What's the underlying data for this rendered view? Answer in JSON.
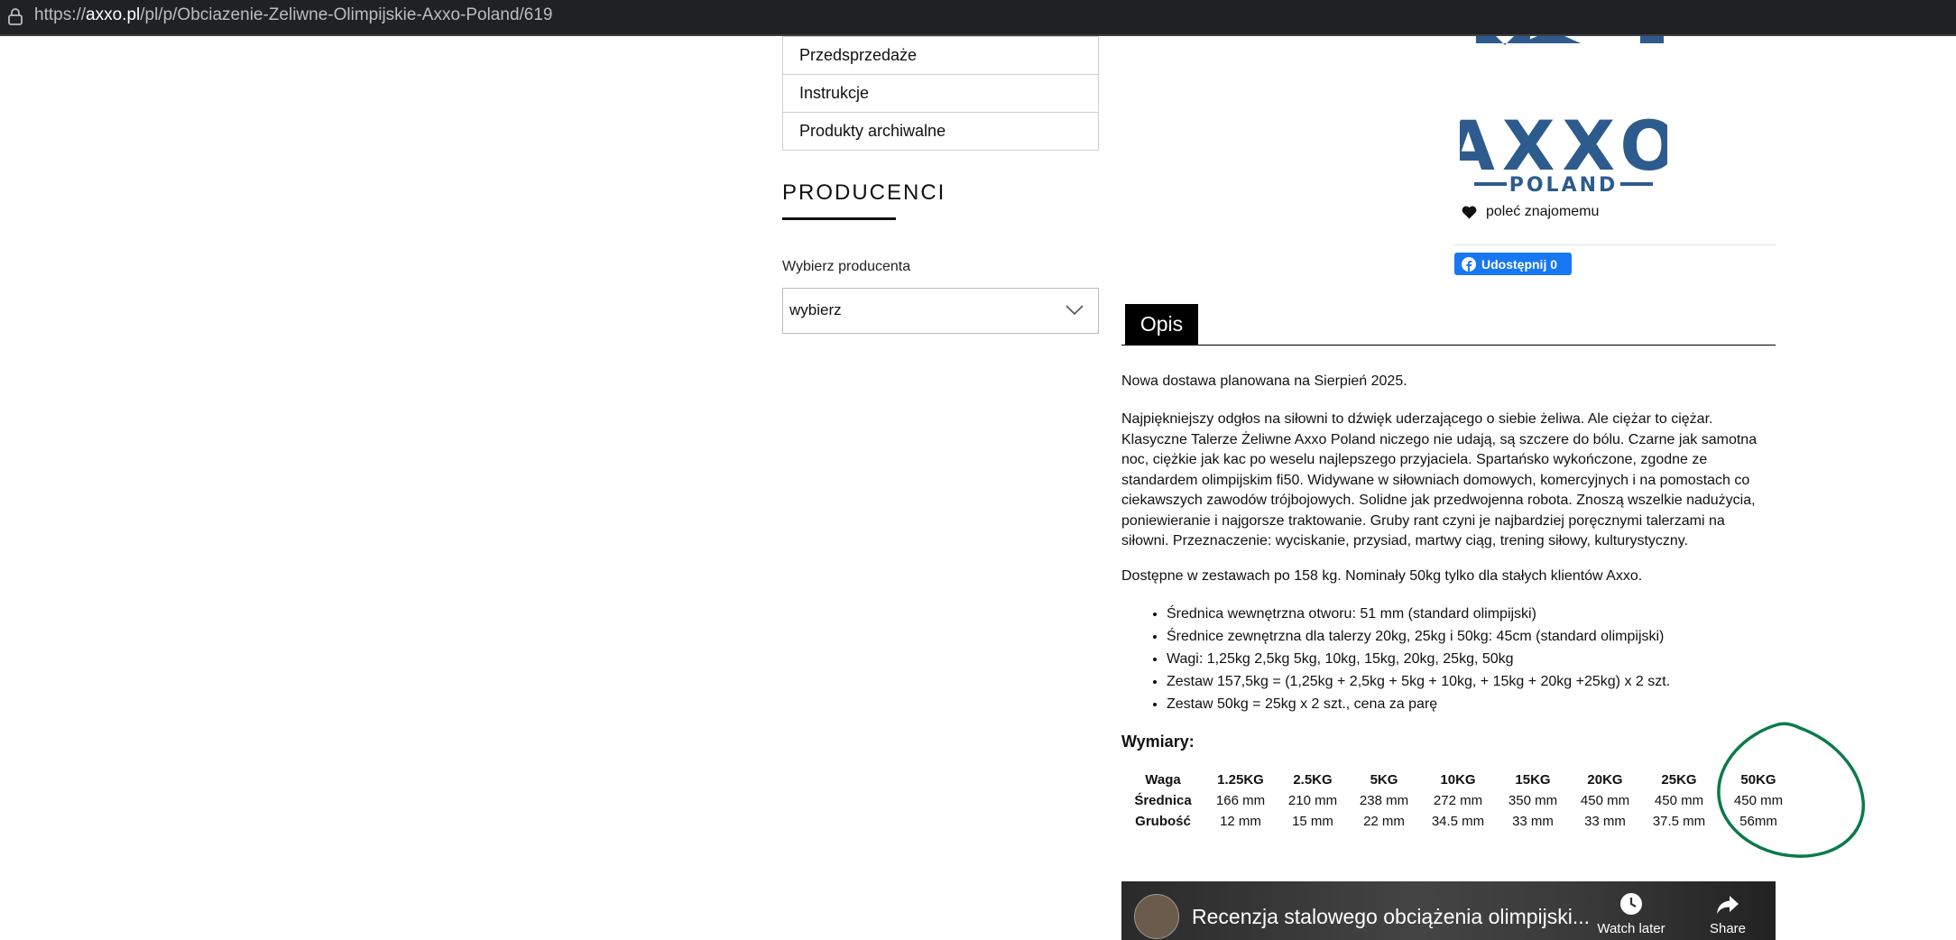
{
  "browser": {
    "url_prefix": "https://",
    "url_host": "axxo.pl",
    "url_path": "/pl/p/Obciazenie-Zeliwne-Olimpijskie-Axxo-Poland/619"
  },
  "sidebar": {
    "menu_items": [
      {
        "label": "Przedsprzedaże"
      },
      {
        "label": "Instrukcje"
      },
      {
        "label": "Produkty archiwalne"
      }
    ],
    "producers_title": "PRODUCENCI",
    "producer_label": "Wybierz producenta",
    "producer_select_value": "wybierz"
  },
  "product": {
    "logo_text_main": "AXXO",
    "logo_text_sub": "POLAND",
    "recommend_label": "poleć znajomemu",
    "fb_share_label": "Udostępnij 0",
    "tab_label": "Opis",
    "paragraphs": [
      "Nowa dostawa planowana na Sierpień 2025.",
      "Najpiękniejszy odgłos na siłowni to dźwięk uderzającego o siebie żeliwa. Ale ciężar to ciężar. Klasyczne Talerze Żeliwne Axxo Poland niczego nie udają, są szczere do bólu. Czarne jak samotna noc, ciężkie jak kac po weselu najlepszego przyjaciela. Spartańsko wykończone, zgodne ze standardem olimpijskim fi50. Widywane w siłowniach domowych, komercyjnych i na pomostach co ciekawszych zawodów trójbojowych. Solidne jak przedwojenna robota. Znoszą wszelkie nadużycia, poniewieranie i najgorsze traktowanie. Gruby rant czyni je najbardziej poręcznymi talerzami na siłowni. Przeznaczenie: wyciskanie, przysiad, martwy ciąg, trening siłowy, kulturystyczny.",
      "Dostępne w zestawach po 158 kg. Nominały 50kg tylko dla stałych klientów Axxo."
    ],
    "bullets": [
      "Średnica wewnętrzna otworu: 51 mm (standard olimpijski)",
      "Średnice zewnętrzna dla talerzy 20kg, 25kg i 50kg: 45cm (standard olimpijski)",
      "Wagi: 1,25kg 2,5kg 5kg, 10kg, 15kg, 20kg, 25kg, 50kg",
      "Zestaw 157,5kg = (1,25kg + 2,5kg + 5kg + 10kg, + 15kg + 20kg +25kg) x 2 szt.",
      "Zestaw 50kg = 25kg x 2 szt., cena za parę"
    ],
    "dimensions_title": "Wymiary:",
    "dimensions": {
      "headers": [
        "Waga",
        "1.25KG",
        "2.5KG",
        "5KG",
        "10KG",
        "15KG",
        "20KG",
        "25KG",
        "50KG"
      ],
      "rows": [
        [
          "Średnica",
          "166 mm",
          "210 mm",
          "238 mm",
          "272 mm",
          "350 mm",
          "450 mm",
          "450 mm",
          "450 mm"
        ],
        [
          "Grubość",
          "12 mm",
          "15 mm",
          "22 mm",
          "34.5 mm",
          "33 mm",
          "33 mm",
          "37.5 mm",
          "56mm"
        ]
      ]
    },
    "video": {
      "title": "Recenzja stalowego obciążenia olimpijski...",
      "watch_later": "Watch later",
      "share": "Share"
    }
  },
  "colors": {
    "annotation_circle": "#0b7a4a",
    "logo_blue": "#2e5b8e",
    "fb_blue": "#1877f2"
  }
}
